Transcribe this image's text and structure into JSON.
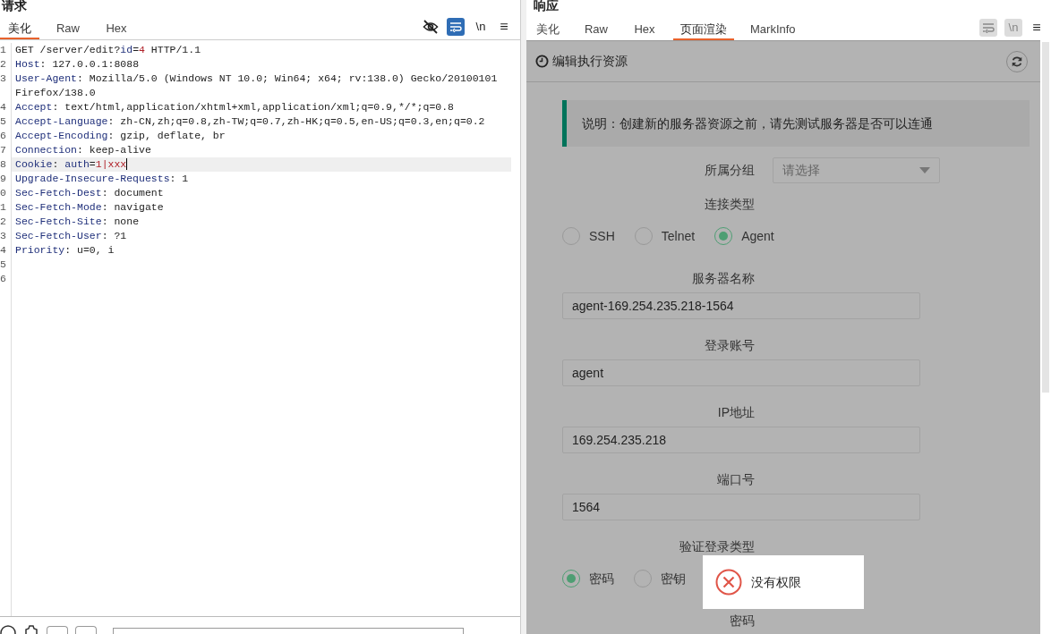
{
  "request": {
    "title": "请求",
    "tabs": [
      {
        "label": "美化",
        "selected": true
      },
      {
        "label": "Raw",
        "selected": false
      },
      {
        "label": "Hex",
        "selected": false
      }
    ],
    "toolbar": [
      {
        "kind": "hide",
        "active": false
      },
      {
        "kind": "wrap",
        "active": true
      },
      {
        "kind": "newline",
        "label": "\\n",
        "active": false
      },
      {
        "kind": "menu",
        "label": "≡",
        "active": false
      }
    ],
    "lines": [
      {
        "number": "1",
        "highlighted": false,
        "tokens": [
          {
            "text": "GET /server/edit?",
            "kind": "plain"
          },
          {
            "text": "id",
            "kind": "key"
          },
          {
            "text": "=",
            "kind": "plain"
          },
          {
            "text": "4",
            "kind": "value"
          },
          {
            "text": " HTTP/1.1",
            "kind": "plain"
          }
        ]
      },
      {
        "number": "2",
        "highlighted": false,
        "tokens": [
          {
            "text": "Host",
            "kind": "key"
          },
          {
            "text": ": 127.0.0.1:8088",
            "kind": "plain"
          }
        ]
      },
      {
        "number": "3",
        "highlighted": false,
        "tokens": [
          {
            "text": "User-Agent",
            "kind": "key"
          },
          {
            "text": ": Mozilla/5.0 (Windows NT 10.0; Win64; x64; rv:138.0) Gecko/20100101 Firefox/138.0",
            "kind": "plain"
          }
        ]
      },
      {
        "number": "4",
        "highlighted": false,
        "tokens": [
          {
            "text": "Accept",
            "kind": "key"
          },
          {
            "text": ": text/html,application/xhtml+xml,application/xml;q=0.9,*/*;q=0.8",
            "kind": "plain"
          }
        ]
      },
      {
        "number": "5",
        "highlighted": false,
        "tokens": [
          {
            "text": "Accept-Language",
            "kind": "key"
          },
          {
            "text": ": zh-CN,zh;q=0.8,zh-TW;q=0.7,zh-HK;q=0.5,en-US;q=0.3,en;q=0.2",
            "kind": "plain"
          }
        ]
      },
      {
        "number": "6",
        "highlighted": false,
        "tokens": [
          {
            "text": "Accept-Encoding",
            "kind": "key"
          },
          {
            "text": ": gzip, deflate, br",
            "kind": "plain"
          }
        ]
      },
      {
        "number": "7",
        "highlighted": false,
        "tokens": [
          {
            "text": "Connection",
            "kind": "key"
          },
          {
            "text": ": keep-alive",
            "kind": "plain"
          }
        ]
      },
      {
        "number": "8",
        "highlighted": true,
        "tokens": [
          {
            "text": "Cookie",
            "kind": "key"
          },
          {
            "text": ": ",
            "kind": "plain"
          },
          {
            "text": "auth",
            "kind": "key"
          },
          {
            "text": "=",
            "kind": "plain"
          },
          {
            "text": "1|xxx",
            "kind": "value"
          }
        ]
      },
      {
        "number": "9",
        "highlighted": false,
        "tokens": [
          {
            "text": "Upgrade-Insecure-Requests",
            "kind": "key"
          },
          {
            "text": ": 1",
            "kind": "plain"
          }
        ]
      },
      {
        "number": "0",
        "highlighted": false,
        "tokens": [
          {
            "text": "Sec-Fetch-Dest",
            "kind": "key"
          },
          {
            "text": ": document",
            "kind": "plain"
          }
        ]
      },
      {
        "number": "1",
        "highlighted": false,
        "tokens": [
          {
            "text": "Sec-Fetch-Mode",
            "kind": "key"
          },
          {
            "text": ": navigate",
            "kind": "plain"
          }
        ]
      },
      {
        "number": "2",
        "highlighted": false,
        "tokens": [
          {
            "text": "Sec-Fetch-Site",
            "kind": "key"
          },
          {
            "text": ": none",
            "kind": "plain"
          }
        ]
      },
      {
        "number": "3",
        "highlighted": false,
        "tokens": [
          {
            "text": "Sec-Fetch-User",
            "kind": "key"
          },
          {
            "text": ": ?1",
            "kind": "plain"
          }
        ]
      },
      {
        "number": "4",
        "highlighted": false,
        "tokens": [
          {
            "text": "Priority",
            "kind": "key"
          },
          {
            "text": ": u=0, i",
            "kind": "plain"
          }
        ]
      },
      {
        "number": "5",
        "highlighted": false
      },
      {
        "number": "6",
        "highlighted": false
      }
    ]
  },
  "response": {
    "title": "响应",
    "tabs": [
      {
        "label": "美化",
        "selected": false
      },
      {
        "label": "Raw",
        "selected": false
      },
      {
        "label": "Hex",
        "selected": false
      },
      {
        "label": "页面渲染",
        "selected": true
      },
      {
        "label": "MarkInfo",
        "selected": false
      }
    ],
    "toolbar": [
      {
        "kind": "wrap",
        "active": false
      },
      {
        "kind": "newline",
        "label": "\\n",
        "active": false
      },
      {
        "kind": "menu",
        "label": "≡",
        "active": false
      }
    ],
    "page": {
      "title": "编辑执行资源",
      "notice": "说明：创建新的服务器资源之前，请先测试服务器是否可以连通",
      "fields": [
        {
          "kind": "select",
          "label": "所属分组",
          "placeholder": "请选择"
        },
        {
          "kind": "radio",
          "label": "连接类型",
          "options": [
            {
              "label": "SSH",
              "selected": false
            },
            {
              "label": "Telnet",
              "selected": false
            },
            {
              "label": "Agent",
              "selected": true
            }
          ]
        },
        {
          "kind": "text",
          "label": "服务器名称",
          "value": "agent-169.254.235.218-1564"
        },
        {
          "kind": "text",
          "label": "登录账号",
          "value": "agent"
        },
        {
          "kind": "text",
          "label": "IP地址",
          "value": "169.254.235.218"
        },
        {
          "kind": "text",
          "label": "端口号",
          "value": "1564"
        },
        {
          "kind": "radio",
          "label": "验证登录类型",
          "options": [
            {
              "label": "密码",
              "selected": true
            },
            {
              "label": "密钥",
              "selected": false
            }
          ]
        },
        {
          "kind": "label",
          "label": "密码"
        }
      ],
      "toast": {
        "message": "没有权限"
      }
    }
  }
}
